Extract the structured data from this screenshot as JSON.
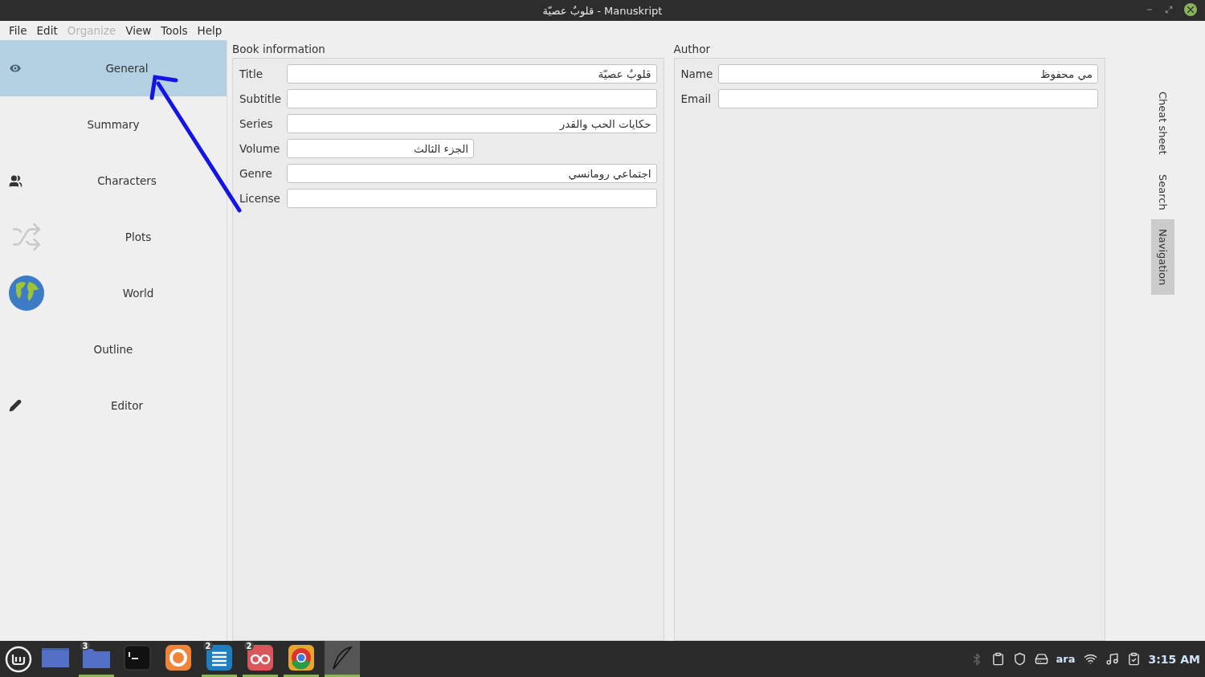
{
  "window": {
    "title": "قلوبٌ عصيّة - Manuskript"
  },
  "menu": [
    {
      "label": "File",
      "disabled": false
    },
    {
      "label": "Edit",
      "disabled": false
    },
    {
      "label": "Organize",
      "disabled": true
    },
    {
      "label": "View",
      "disabled": false
    },
    {
      "label": "Tools",
      "disabled": false
    },
    {
      "label": "Help",
      "disabled": false
    }
  ],
  "sidebar": {
    "items": [
      {
        "label": "General",
        "selected": true
      },
      {
        "label": "Summary",
        "selected": false
      },
      {
        "label": "Characters",
        "selected": false
      },
      {
        "label": "Plots",
        "selected": false
      },
      {
        "label": "World",
        "selected": false
      },
      {
        "label": "Outline",
        "selected": false
      },
      {
        "label": "Editor",
        "selected": false
      }
    ]
  },
  "book_information": {
    "heading": "Book information",
    "fields": [
      {
        "label": "Title",
        "value": "قلوبٌ عصيّة",
        "kind": "wide"
      },
      {
        "label": "Subtitle",
        "kind": "wide"
      },
      {
        "label": "Series",
        "value": "حكايات الحب والقدر",
        "kind": "wide"
      },
      {
        "label": "Volume",
        "value": "الجزء الثالث",
        "kind": "short"
      },
      {
        "label": "Genre",
        "value": "اجتماعي رومانسي",
        "kind": "wide"
      },
      {
        "label": "License",
        "kind": "wide"
      }
    ]
  },
  "author": {
    "heading": "Author",
    "fields": [
      {
        "label": "Name",
        "value": "مي محفوظ",
        "kind": "wide"
      },
      {
        "label": "Email",
        "kind": "wide"
      }
    ]
  },
  "dock_tabs": [
    {
      "label": "Cheat sheet",
      "selected": false
    },
    {
      "label": "Search",
      "selected": false
    },
    {
      "label": "Navigation",
      "selected": true
    }
  ],
  "taskbar": {
    "apps": [
      {
        "kind": "window",
        "running": false
      },
      {
        "kind": "folder",
        "badge": "3",
        "running": true
      },
      {
        "kind": "terminal",
        "running": false
      },
      {
        "kind": "firefox",
        "running": false
      },
      {
        "kind": "writer",
        "badge": "2",
        "running": true
      },
      {
        "kind": "reader",
        "badge": "2",
        "running": true
      },
      {
        "kind": "chrome",
        "running": true
      },
      {
        "kind": "quill",
        "running": true,
        "selected": true
      }
    ],
    "language": "ara",
    "clock": "3:15 AM"
  }
}
